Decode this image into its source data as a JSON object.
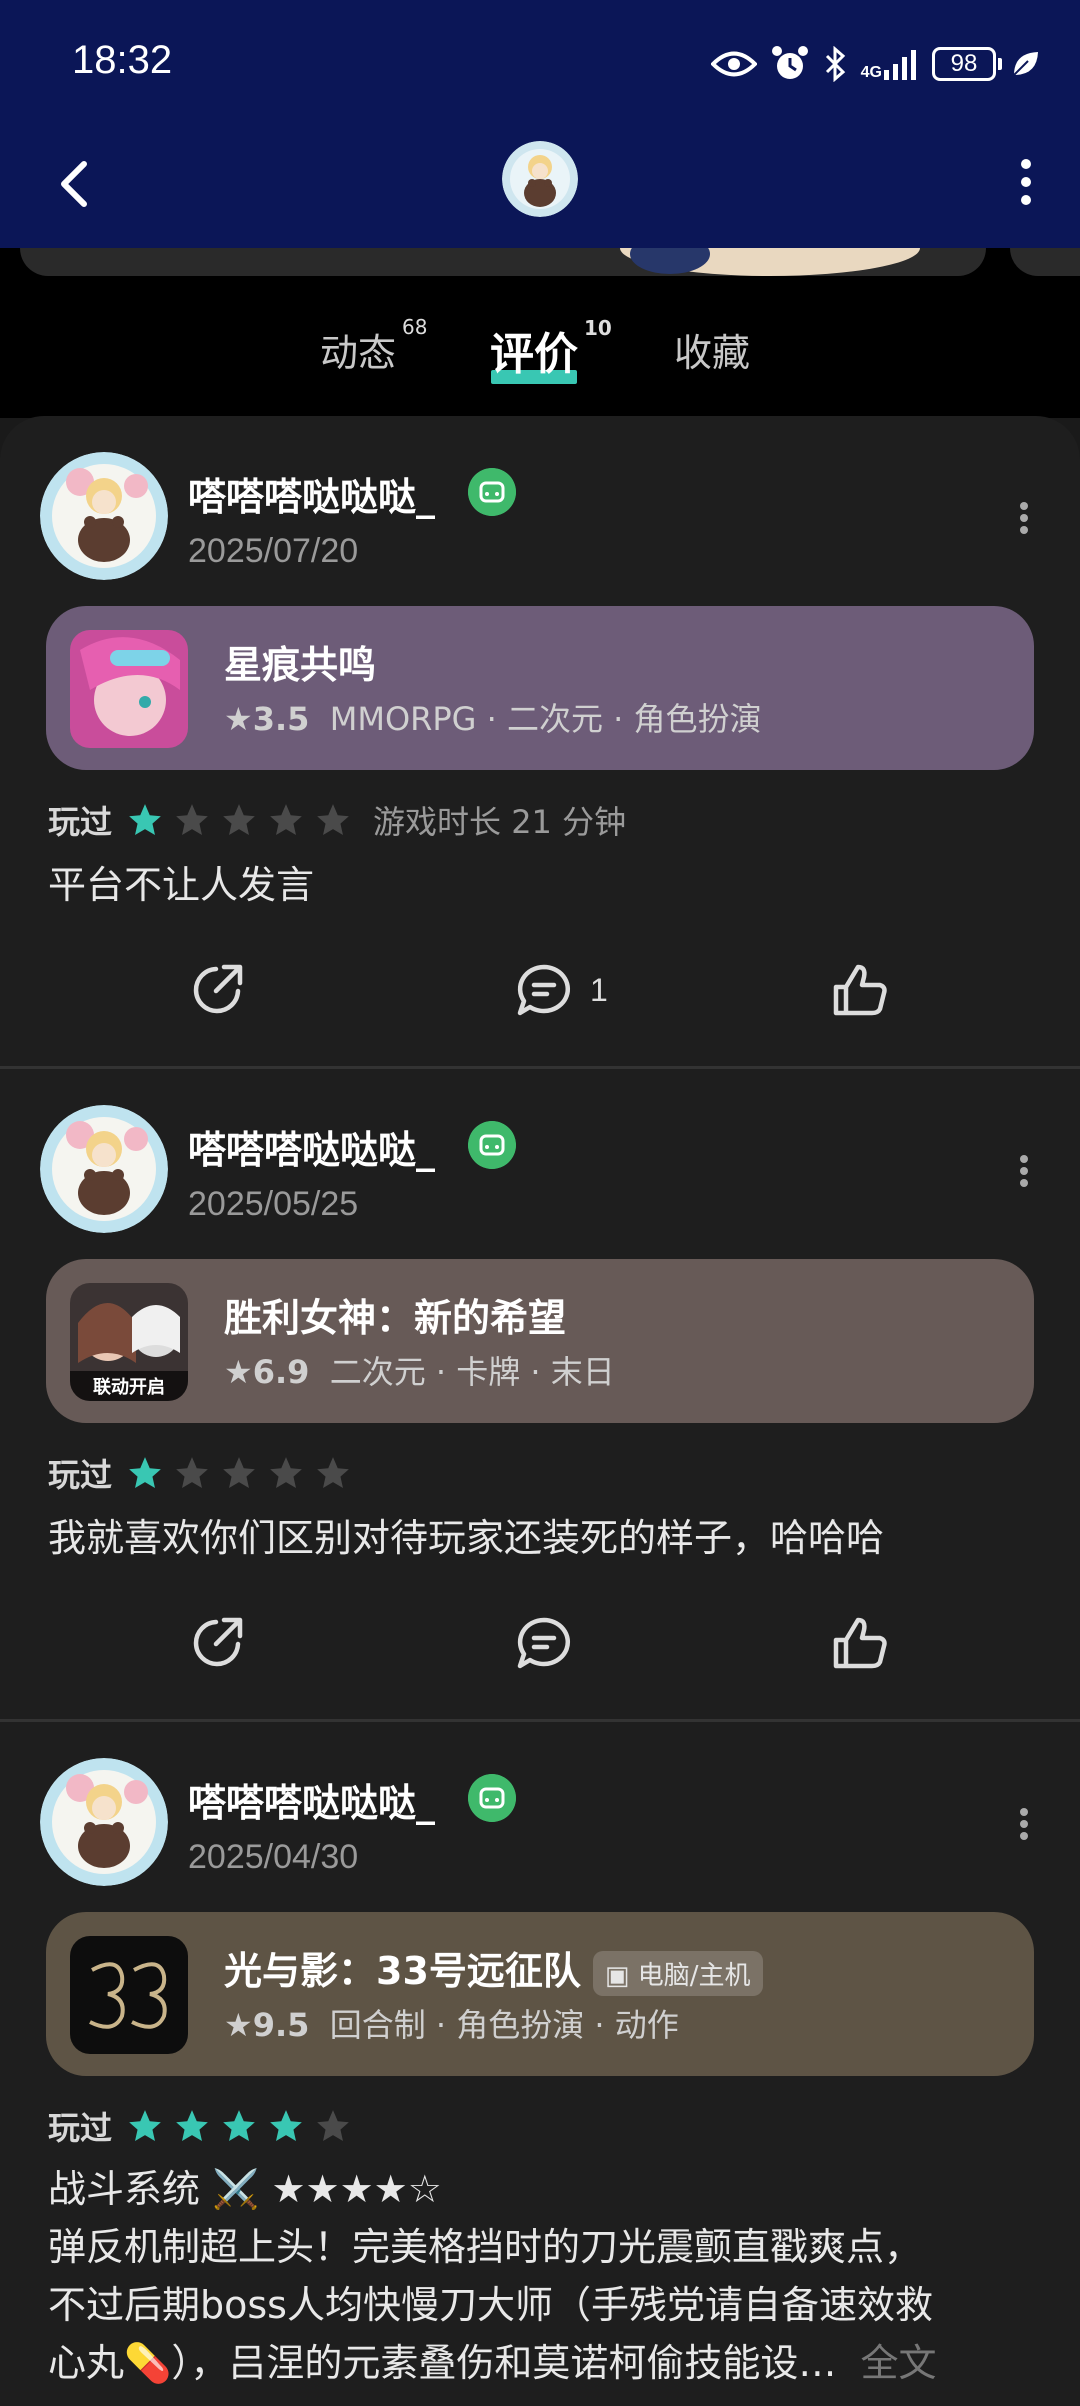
{
  "status_bar": {
    "time": "18:32",
    "network": "4G",
    "battery": "98"
  },
  "tabs": [
    {
      "label": "动态",
      "count": "68"
    },
    {
      "label": "评价",
      "count": "10"
    },
    {
      "label": "收藏",
      "count": ""
    }
  ],
  "reviews": [
    {
      "user": "嗒嗒嗒哒哒哒_",
      "date": "2025/07/20",
      "game": {
        "title": "星痕共鸣",
        "rating": "3.5",
        "tags": "MMORPG · 二次元 · 角色扮演",
        "platform": "",
        "box_color": "#6d5c78"
      },
      "played_label": "玩过",
      "stars": 1,
      "playtime": "游戏时长 21 分钟",
      "text": "平台不让人发言",
      "comment_count": "1"
    },
    {
      "user": "嗒嗒嗒哒哒哒_",
      "date": "2025/05/25",
      "game": {
        "title": "胜利女神：新的希望",
        "rating": "6.9",
        "tags": "二次元 · 卡牌 · 末日",
        "platform": "",
        "box_color": "#675a57",
        "icon_text": "联动开启"
      },
      "played_label": "玩过",
      "stars": 1,
      "playtime": "",
      "text": "我就喜欢你们区别对待玩家还装死的样子，哈哈哈",
      "comment_count": ""
    },
    {
      "user": "嗒嗒嗒哒哒哒_",
      "date": "2025/04/30",
      "game": {
        "title": "光与影：33号远征队",
        "rating": "9.5",
        "tags": "回合制 · 角色扮演 · 动作",
        "platform": "电脑/主机",
        "box_color": "#5e5445"
      },
      "played_label": "玩过",
      "stars": 4,
      "playtime": "",
      "text_line1": "战斗系统 ⚔️ ★★★★☆",
      "text_line2": "弹反机制超上头！完美格挡时的刀光震颤直戳爽点，",
      "text_line3": "不过后期boss人均快慢刀大师（手残党请自备速效救",
      "text_line4": "心丸💊），吕涅的元素叠伤和莫诺柯偷技能设…",
      "more": "全文"
    }
  ],
  "colors": {
    "accent": "#39c7b3",
    "header_bg": "#0b1657",
    "badge": "#3fb96b"
  }
}
